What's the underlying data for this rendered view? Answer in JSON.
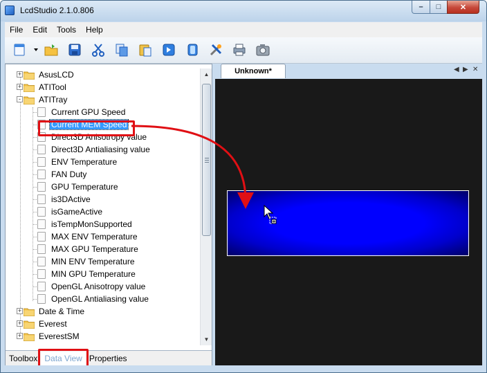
{
  "window": {
    "title": "LcdStudio 2.1.0.806"
  },
  "menu": [
    "File",
    "Edit",
    "Tools",
    "Help"
  ],
  "toolbar": {
    "icons": [
      "new-document-icon",
      "open-folder-icon",
      "save-icon",
      "cut-icon",
      "copy-icon",
      "paste-icon",
      "forward-icon",
      "layers-icon",
      "tools-icon",
      "print-icon",
      "camera-icon"
    ]
  },
  "tree": {
    "items": [
      {
        "label": "AsusLCD",
        "type": "folder",
        "level": 0,
        "expander": "+"
      },
      {
        "label": "ATITool",
        "type": "folder",
        "level": 0,
        "expander": "+"
      },
      {
        "label": "ATITray",
        "type": "folder",
        "level": 0,
        "expander": "-"
      },
      {
        "label": "Current GPU Speed",
        "type": "item",
        "level": 1
      },
      {
        "label": "Current MEM Speed",
        "type": "item",
        "level": 1,
        "selected": true
      },
      {
        "label": "Direct3D Anisotropy value",
        "type": "item",
        "level": 1
      },
      {
        "label": "Direct3D Antialiasing value",
        "type": "item",
        "level": 1
      },
      {
        "label": "ENV Temperature",
        "type": "item",
        "level": 1
      },
      {
        "label": "FAN Duty",
        "type": "item",
        "level": 1
      },
      {
        "label": "GPU Temperature",
        "type": "item",
        "level": 1
      },
      {
        "label": "is3DActive",
        "type": "item",
        "level": 1
      },
      {
        "label": "isGameActive",
        "type": "item",
        "level": 1
      },
      {
        "label": "isTempMonSupported",
        "type": "item",
        "level": 1
      },
      {
        "label": "MAX ENV Temperature",
        "type": "item",
        "level": 1
      },
      {
        "label": "MAX GPU Temperature",
        "type": "item",
        "level": 1
      },
      {
        "label": "MIN ENV Temperature",
        "type": "item",
        "level": 1
      },
      {
        "label": "MIN GPU Temperature",
        "type": "item",
        "level": 1
      },
      {
        "label": "OpenGL Anisotropy value",
        "type": "item",
        "level": 1
      },
      {
        "label": "OpenGL Antialiasing value",
        "type": "item",
        "level": 1
      },
      {
        "label": "Date & Time",
        "type": "folder",
        "level": 0,
        "expander": "+"
      },
      {
        "label": "Everest",
        "type": "folder",
        "level": 0,
        "expander": "+"
      },
      {
        "label": "EverestSM",
        "type": "folder",
        "level": 0,
        "expander": "+"
      }
    ]
  },
  "bottom_tabs": [
    {
      "label": "Toolbox",
      "active": false
    },
    {
      "label": "Data View",
      "active": true
    },
    {
      "label": "Properties",
      "active": false
    }
  ],
  "document_tab": {
    "label": "Unknown*"
  },
  "colors": {
    "highlight_red": "#e00f14",
    "selection_blue": "#3399ff",
    "lcd_blue": "#0000ff",
    "canvas_bg": "#191919"
  }
}
